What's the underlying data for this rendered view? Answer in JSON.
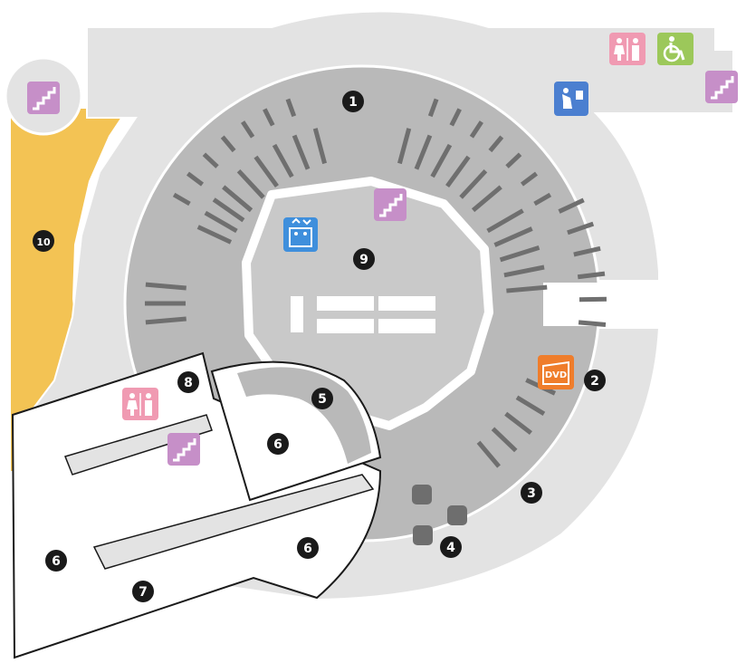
{
  "map": {
    "colors": {
      "outer_floor": "#e3e3e3",
      "ring_floor": "#b9b9b9",
      "core_floor": "#c9c9c9",
      "wall": "#ffffff",
      "seat_bar": "#6f6f6f",
      "annex": "#f3c354",
      "marker": "#1a1a1a",
      "stairs": "#c68fc8",
      "restroom": "#f09ab2",
      "accessible": "#9cc85a",
      "lift": "#3f8fdc",
      "dvd": "#ef7d2b",
      "water": "#4b7fd0",
      "pillar": "#6e6e6e"
    },
    "markers": [
      {
        "id": "m1",
        "label": "1"
      },
      {
        "id": "m2",
        "label": "2"
      },
      {
        "id": "m3",
        "label": "3"
      },
      {
        "id": "m4",
        "label": "4"
      },
      {
        "id": "m5",
        "label": "5"
      },
      {
        "id": "m6a",
        "label": "6"
      },
      {
        "id": "m6b",
        "label": "6"
      },
      {
        "id": "m6c",
        "label": "6"
      },
      {
        "id": "m7",
        "label": "7"
      },
      {
        "id": "m8",
        "label": "8"
      },
      {
        "id": "m9",
        "label": "9"
      },
      {
        "id": "m10",
        "label": "10"
      }
    ],
    "icons": {
      "stairs": "stairs-icon",
      "restroom": "restroom-icon",
      "accessible": "wheelchair-icon",
      "lift": "elevator-icon",
      "dvd": "dvd-icon",
      "water": "drinking-fountain-icon"
    }
  }
}
